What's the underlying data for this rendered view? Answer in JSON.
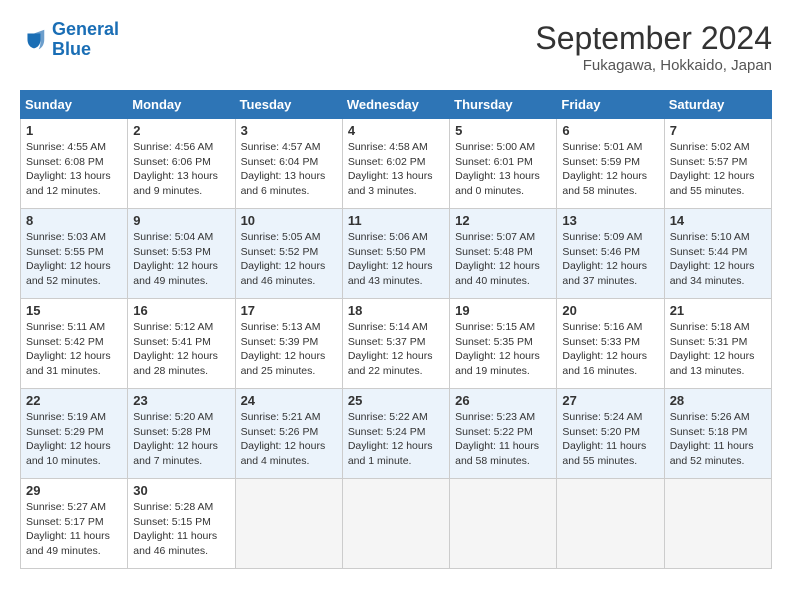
{
  "header": {
    "logo_line1": "General",
    "logo_line2": "Blue",
    "title": "September 2024",
    "location": "Fukagawa, Hokkaido, Japan"
  },
  "columns": [
    "Sunday",
    "Monday",
    "Tuesday",
    "Wednesday",
    "Thursday",
    "Friday",
    "Saturday"
  ],
  "weeks": [
    [
      {
        "day": "1",
        "lines": [
          "Sunrise: 4:55 AM",
          "Sunset: 6:08 PM",
          "Daylight: 13 hours",
          "and 12 minutes."
        ]
      },
      {
        "day": "2",
        "lines": [
          "Sunrise: 4:56 AM",
          "Sunset: 6:06 PM",
          "Daylight: 13 hours",
          "and 9 minutes."
        ]
      },
      {
        "day": "3",
        "lines": [
          "Sunrise: 4:57 AM",
          "Sunset: 6:04 PM",
          "Daylight: 13 hours",
          "and 6 minutes."
        ]
      },
      {
        "day": "4",
        "lines": [
          "Sunrise: 4:58 AM",
          "Sunset: 6:02 PM",
          "Daylight: 13 hours",
          "and 3 minutes."
        ]
      },
      {
        "day": "5",
        "lines": [
          "Sunrise: 5:00 AM",
          "Sunset: 6:01 PM",
          "Daylight: 13 hours",
          "and 0 minutes."
        ]
      },
      {
        "day": "6",
        "lines": [
          "Sunrise: 5:01 AM",
          "Sunset: 5:59 PM",
          "Daylight: 12 hours",
          "and 58 minutes."
        ]
      },
      {
        "day": "7",
        "lines": [
          "Sunrise: 5:02 AM",
          "Sunset: 5:57 PM",
          "Daylight: 12 hours",
          "and 55 minutes."
        ]
      }
    ],
    [
      {
        "day": "8",
        "lines": [
          "Sunrise: 5:03 AM",
          "Sunset: 5:55 PM",
          "Daylight: 12 hours",
          "and 52 minutes."
        ]
      },
      {
        "day": "9",
        "lines": [
          "Sunrise: 5:04 AM",
          "Sunset: 5:53 PM",
          "Daylight: 12 hours",
          "and 49 minutes."
        ]
      },
      {
        "day": "10",
        "lines": [
          "Sunrise: 5:05 AM",
          "Sunset: 5:52 PM",
          "Daylight: 12 hours",
          "and 46 minutes."
        ]
      },
      {
        "day": "11",
        "lines": [
          "Sunrise: 5:06 AM",
          "Sunset: 5:50 PM",
          "Daylight: 12 hours",
          "and 43 minutes."
        ]
      },
      {
        "day": "12",
        "lines": [
          "Sunrise: 5:07 AM",
          "Sunset: 5:48 PM",
          "Daylight: 12 hours",
          "and 40 minutes."
        ]
      },
      {
        "day": "13",
        "lines": [
          "Sunrise: 5:09 AM",
          "Sunset: 5:46 PM",
          "Daylight: 12 hours",
          "and 37 minutes."
        ]
      },
      {
        "day": "14",
        "lines": [
          "Sunrise: 5:10 AM",
          "Sunset: 5:44 PM",
          "Daylight: 12 hours",
          "and 34 minutes."
        ]
      }
    ],
    [
      {
        "day": "15",
        "lines": [
          "Sunrise: 5:11 AM",
          "Sunset: 5:42 PM",
          "Daylight: 12 hours",
          "and 31 minutes."
        ]
      },
      {
        "day": "16",
        "lines": [
          "Sunrise: 5:12 AM",
          "Sunset: 5:41 PM",
          "Daylight: 12 hours",
          "and 28 minutes."
        ]
      },
      {
        "day": "17",
        "lines": [
          "Sunrise: 5:13 AM",
          "Sunset: 5:39 PM",
          "Daylight: 12 hours",
          "and 25 minutes."
        ]
      },
      {
        "day": "18",
        "lines": [
          "Sunrise: 5:14 AM",
          "Sunset: 5:37 PM",
          "Daylight: 12 hours",
          "and 22 minutes."
        ]
      },
      {
        "day": "19",
        "lines": [
          "Sunrise: 5:15 AM",
          "Sunset: 5:35 PM",
          "Daylight: 12 hours",
          "and 19 minutes."
        ]
      },
      {
        "day": "20",
        "lines": [
          "Sunrise: 5:16 AM",
          "Sunset: 5:33 PM",
          "Daylight: 12 hours",
          "and 16 minutes."
        ]
      },
      {
        "day": "21",
        "lines": [
          "Sunrise: 5:18 AM",
          "Sunset: 5:31 PM",
          "Daylight: 12 hours",
          "and 13 minutes."
        ]
      }
    ],
    [
      {
        "day": "22",
        "lines": [
          "Sunrise: 5:19 AM",
          "Sunset: 5:29 PM",
          "Daylight: 12 hours",
          "and 10 minutes."
        ]
      },
      {
        "day": "23",
        "lines": [
          "Sunrise: 5:20 AM",
          "Sunset: 5:28 PM",
          "Daylight: 12 hours",
          "and 7 minutes."
        ]
      },
      {
        "day": "24",
        "lines": [
          "Sunrise: 5:21 AM",
          "Sunset: 5:26 PM",
          "Daylight: 12 hours",
          "and 4 minutes."
        ]
      },
      {
        "day": "25",
        "lines": [
          "Sunrise: 5:22 AM",
          "Sunset: 5:24 PM",
          "Daylight: 12 hours",
          "and 1 minute."
        ]
      },
      {
        "day": "26",
        "lines": [
          "Sunrise: 5:23 AM",
          "Sunset: 5:22 PM",
          "Daylight: 11 hours",
          "and 58 minutes."
        ]
      },
      {
        "day": "27",
        "lines": [
          "Sunrise: 5:24 AM",
          "Sunset: 5:20 PM",
          "Daylight: 11 hours",
          "and 55 minutes."
        ]
      },
      {
        "day": "28",
        "lines": [
          "Sunrise: 5:26 AM",
          "Sunset: 5:18 PM",
          "Daylight: 11 hours",
          "and 52 minutes."
        ]
      }
    ],
    [
      {
        "day": "29",
        "lines": [
          "Sunrise: 5:27 AM",
          "Sunset: 5:17 PM",
          "Daylight: 11 hours",
          "and 49 minutes."
        ]
      },
      {
        "day": "30",
        "lines": [
          "Sunrise: 5:28 AM",
          "Sunset: 5:15 PM",
          "Daylight: 11 hours",
          "and 46 minutes."
        ]
      },
      null,
      null,
      null,
      null,
      null
    ]
  ]
}
